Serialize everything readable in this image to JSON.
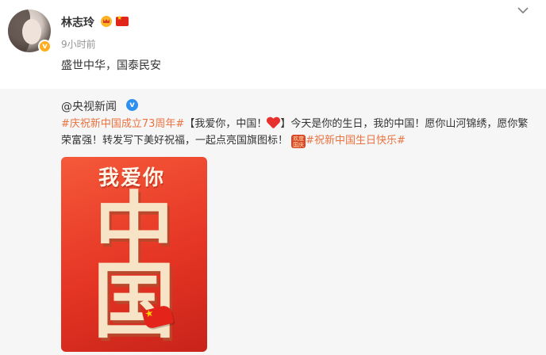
{
  "post": {
    "username": "林志玲",
    "timestamp": "9小时前",
    "text": "盛世中华，国泰民安",
    "verified_mark": "v"
  },
  "repost": {
    "author": "@央视新闻",
    "verified_mark": "v",
    "hashtag1": "#庆祝新中国成立73周年#",
    "text_part1": "【我爱你，中国！",
    "text_part2": "】今天是你的生日，我的中国！愿你山河锦绣，愿你繁荣富强！转发写下美好祝福，一起点亮国旗图标！",
    "festival_icon_text": "欢度国庆",
    "hashtag2": "#祝新中国生日快乐#"
  },
  "poster": {
    "title": "我爱你",
    "char1": "中",
    "char2": "国"
  },
  "colors": {
    "hashtag": "#eb7340",
    "poster_red": "#e53524",
    "verified_blue": "#2d8fef"
  }
}
